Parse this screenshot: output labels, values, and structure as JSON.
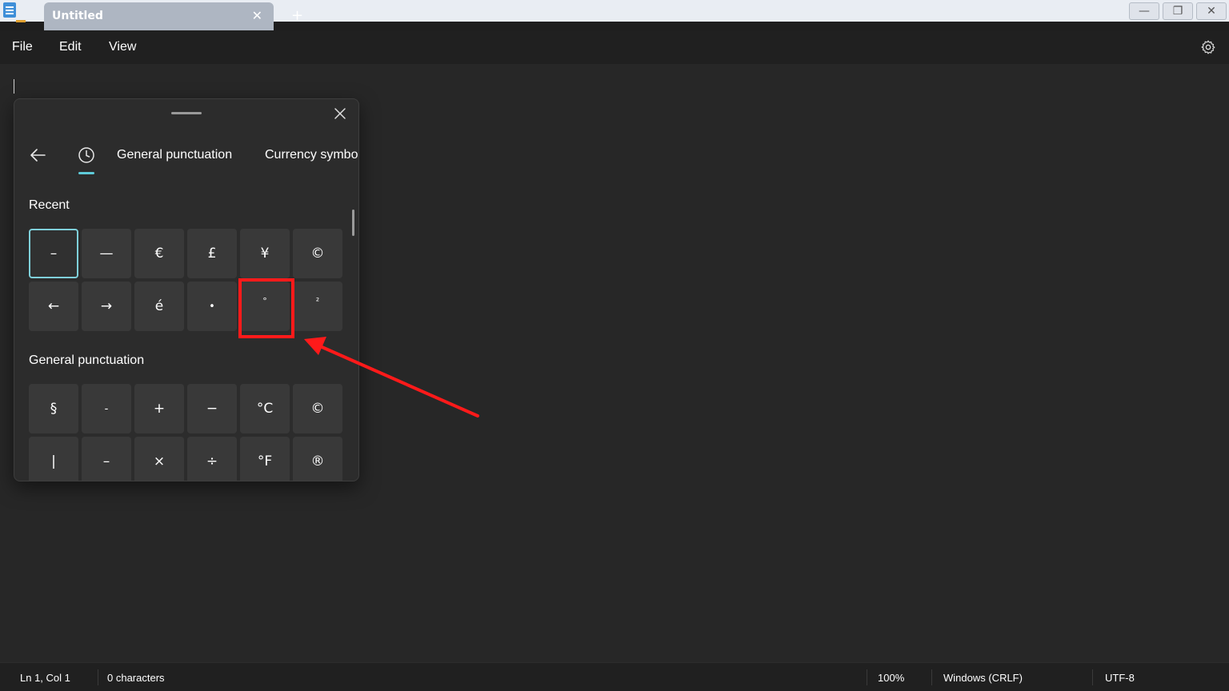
{
  "window": {
    "tab_title": "Untitled",
    "tab_close_glyph": "✕",
    "new_tab_glyph": "+",
    "minimize_glyph": "—",
    "restore_glyph": "❐",
    "close_glyph": "✕"
  },
  "menu": {
    "file": "File",
    "edit": "Edit",
    "view": "View"
  },
  "panel": {
    "tabs": [
      "General punctuation",
      "Currency symbols"
    ],
    "recent_label": "Recent",
    "recent": [
      "–",
      "—",
      "€",
      "£",
      "¥",
      "©",
      "←",
      "→",
      "é",
      "•",
      "°",
      "²"
    ],
    "general_label": "General punctuation",
    "general": [
      "§",
      "-",
      "+",
      "−",
      "°C",
      "©",
      "|",
      "–",
      "×",
      "÷",
      "°F",
      "®"
    ]
  },
  "status": {
    "position": "Ln 1, Col 1",
    "characters": "0 characters",
    "zoom": "100%",
    "line_ending": "Windows (CRLF)",
    "encoding": "UTF-8"
  },
  "colors": {
    "accent": "#5ecbd9",
    "annotation": "#ff1a1a",
    "background": "#272727"
  }
}
